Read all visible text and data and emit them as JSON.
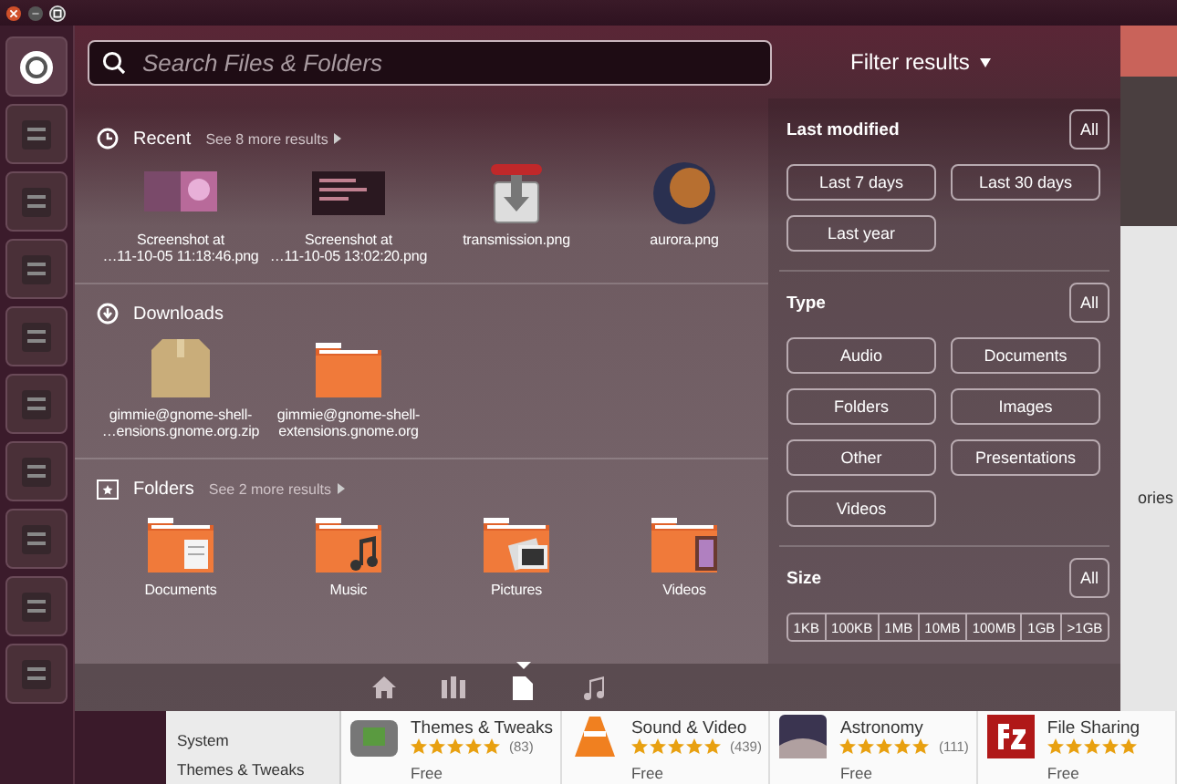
{
  "search": {
    "placeholder": "Search Files & Folders"
  },
  "filter": {
    "title": "Filter results",
    "sections": [
      {
        "title": "Last modified",
        "all": "All",
        "kind": "buttons",
        "options": [
          "Last 7 days",
          "Last 30 days",
          "Last year"
        ]
      },
      {
        "title": "Type",
        "all": "All",
        "kind": "buttons",
        "options": [
          "Audio",
          "Documents",
          "Folders",
          "Images",
          "Other",
          "Presentations",
          "Videos"
        ]
      },
      {
        "title": "Size",
        "all": "All",
        "kind": "segments",
        "options": [
          "1KB",
          "100KB",
          "1MB",
          "10MB",
          "100MB",
          "1GB",
          ">1GB"
        ]
      }
    ]
  },
  "groups": [
    {
      "title": "Recent",
      "kind": "recent",
      "more": "See 8 more results",
      "items": [
        {
          "label": "Screenshot at\n…11-10-05 11:18:46.png",
          "kind": "screenshot-light"
        },
        {
          "label": "Screenshot at\n…11-10-05 13:02:20.png",
          "kind": "screenshot-dark"
        },
        {
          "label": "transmission.png",
          "kind": "package"
        },
        {
          "label": "aurora.png",
          "kind": "sphere"
        }
      ]
    },
    {
      "title": "Downloads",
      "kind": "downloads",
      "items": [
        {
          "label": "gimmie@gnome-shell-\n…ensions.gnome.org.zip",
          "kind": "zip"
        },
        {
          "label": "gimmie@gnome-shell-\nextensions.gnome.org",
          "kind": "folder"
        }
      ]
    },
    {
      "title": "Folders",
      "kind": "folders",
      "more": "See 2 more results",
      "items": [
        {
          "label": "Documents",
          "kind": "folder-documents"
        },
        {
          "label": "Music",
          "kind": "folder-music"
        },
        {
          "label": "Pictures",
          "kind": "folder-pictures"
        },
        {
          "label": "Videos",
          "kind": "folder-videos"
        }
      ]
    }
  ],
  "lenses": [
    {
      "kind": "home",
      "selected": false
    },
    {
      "kind": "applications",
      "selected": false
    },
    {
      "kind": "files",
      "selected": true
    },
    {
      "kind": "music",
      "selected": false
    }
  ],
  "software_center": {
    "side_text": "ories",
    "categories": [
      "System",
      "Themes & Tweaks"
    ],
    "apps": [
      {
        "name": "Themes & Tweaks",
        "kind": "tweaks",
        "stars": 5,
        "count": "(83)",
        "price": "Free"
      },
      {
        "name": "Sound & Video",
        "kind": "cone",
        "stars": 5,
        "count": "(439)",
        "price": "Free"
      },
      {
        "name": "Astronomy",
        "kind": "sky",
        "stars": 5,
        "count": "(111)",
        "price": "Free"
      },
      {
        "name": "File Sharing",
        "kind": "fz",
        "stars": 5,
        "price": "Free"
      }
    ]
  }
}
